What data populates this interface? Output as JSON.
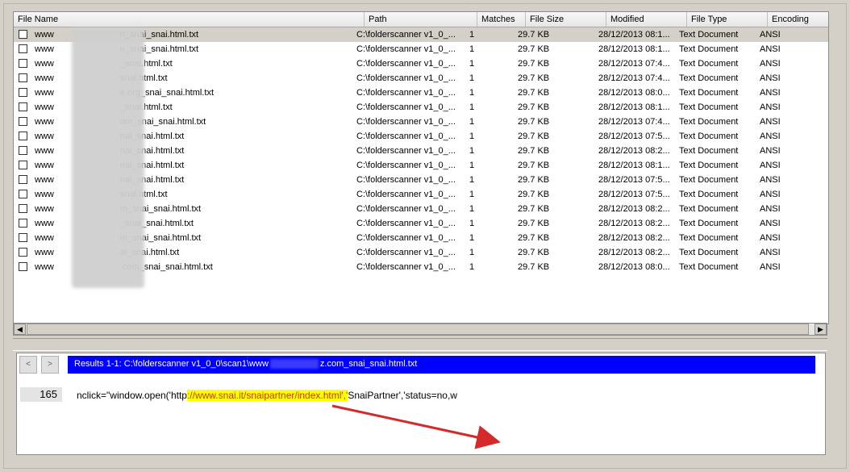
{
  "columns": {
    "name": "File Name",
    "path": "Path",
    "matches": "Matches",
    "size": "File Size",
    "modified": "Modified",
    "type": "File Type",
    "encoding": "Encoding"
  },
  "rows": [
    {
      "name": "www",
      "suffix": "n_snai_snai.html.txt",
      "path": "C:\\folderscanner v1_0_...",
      "matches": "1",
      "size": "29.7 KB",
      "modified": "28/12/2013 08:1...",
      "type": "Text Document",
      "enc": "ANSI",
      "selected": true
    },
    {
      "name": "www",
      "suffix": "n_snai_snai.html.txt",
      "path": "C:\\folderscanner v1_0_...",
      "matches": "1",
      "size": "29.7 KB",
      "modified": "28/12/2013 08:1...",
      "type": "Text Document",
      "enc": "ANSI"
    },
    {
      "name": "www",
      "suffix": "_snai.html.txt",
      "path": "C:\\folderscanner v1_0_...",
      "matches": "1",
      "size": "29.7 KB",
      "modified": "28/12/2013 07:4...",
      "type": "Text Document",
      "enc": "ANSI"
    },
    {
      "name": "www",
      "suffix": "snai.html.txt",
      "path": "C:\\folderscanner v1_0_...",
      "matches": "1",
      "size": "29.7 KB",
      "modified": "28/12/2013 07:4...",
      "type": "Text Document",
      "enc": "ANSI"
    },
    {
      "name": "www",
      "suffix": "e.org_snai_snai.html.txt",
      "path": "C:\\folderscanner v1_0_...",
      "matches": "1",
      "size": "29.7 KB",
      "modified": "28/12/2013 08:0...",
      "type": "Text Document",
      "enc": "ANSI"
    },
    {
      "name": "www",
      "suffix": "_snai.html.txt",
      "path": "C:\\folderscanner v1_0_...",
      "matches": "1",
      "size": "29.7 KB",
      "modified": "28/12/2013 08:1...",
      "type": "Text Document",
      "enc": "ANSI"
    },
    {
      "name": "www",
      "suffix": "om_snai_snai.html.txt",
      "path": "C:\\folderscanner v1_0_...",
      "matches": "1",
      "size": "29.7 KB",
      "modified": "28/12/2013 07:4...",
      "type": "Text Document",
      "enc": "ANSI"
    },
    {
      "name": "www",
      "suffix": "nai_snai.html.txt",
      "path": "C:\\folderscanner v1_0_...",
      "matches": "1",
      "size": "29.7 KB",
      "modified": "28/12/2013 07:5...",
      "type": "Text Document",
      "enc": "ANSI"
    },
    {
      "name": "www",
      "suffix": "nai_snai.html.txt",
      "path": "C:\\folderscanner v1_0_...",
      "matches": "1",
      "size": "29.7 KB",
      "modified": "28/12/2013 08:2...",
      "type": "Text Document",
      "enc": "ANSI"
    },
    {
      "name": "www",
      "suffix": "nai_snai.html.txt",
      "path": "C:\\folderscanner v1_0_...",
      "matches": "1",
      "size": "29.7 KB",
      "modified": "28/12/2013 08:1...",
      "type": "Text Document",
      "enc": "ANSI"
    },
    {
      "name": "www",
      "suffix": "nai_snai.html.txt",
      "path": "C:\\folderscanner v1_0_...",
      "matches": "1",
      "size": "29.7 KB",
      "modified": "28/12/2013 07:5...",
      "type": "Text Document",
      "enc": "ANSI"
    },
    {
      "name": "www",
      "suffix": "snai.html.txt",
      "path": "C:\\folderscanner v1_0_...",
      "matches": "1",
      "size": "29.7 KB",
      "modified": "28/12/2013 07:5...",
      "type": "Text Document",
      "enc": "ANSI"
    },
    {
      "name": "www",
      "suffix": "m_snai_snai.html.txt",
      "path": "C:\\folderscanner v1_0_...",
      "matches": "1",
      "size": "29.7 KB",
      "modified": "28/12/2013 08:2...",
      "type": "Text Document",
      "enc": "ANSI"
    },
    {
      "name": "www",
      "suffix": "_snai_snai.html.txt",
      "path": "C:\\folderscanner v1_0_...",
      "matches": "1",
      "size": "29.7 KB",
      "modified": "28/12/2013 08:2...",
      "type": "Text Document",
      "enc": "ANSI"
    },
    {
      "name": "www",
      "suffix": "m_snai_snai.html.txt",
      "path": "C:\\folderscanner v1_0_...",
      "matches": "1",
      "size": "29.7 KB",
      "modified": "28/12/2013 08:2...",
      "type": "Text Document",
      "enc": "ANSI"
    },
    {
      "name": "www",
      "suffix": "ai_snai.html.txt",
      "path": "C:\\folderscanner v1_0_...",
      "matches": "1",
      "size": "29.7 KB",
      "modified": "28/12/2013 08:2...",
      "type": "Text Document",
      "enc": "ANSI"
    },
    {
      "name": "www",
      "suffix": ".com_snai_snai.html.txt",
      "path": "C:\\folderscanner v1_0_...",
      "matches": "1",
      "size": "29.7 KB",
      "modified": "28/12/2013 08:0...",
      "type": "Text Document",
      "enc": "ANSI"
    }
  ],
  "preview": {
    "prev_label": "<",
    "next_label": ">",
    "results_prefix": "Results 1-1: C:\\folderscanner v1_0_0\\scan1\\www",
    "results_suffix": "z.com_snai_snai.html.txt",
    "line_number": "165",
    "code_before": "nclick=\"window.open('http",
    "code_match": "://www.snai.it/snaipartner/index.html','",
    "code_after": "SnaiPartner','status=no,w"
  },
  "scrollbar": {
    "left_arrow": "◀",
    "right_arrow": "▶"
  },
  "colors": {
    "results_bar": "#0000ff",
    "highlight": "#ffff00",
    "arrow": "#d42a2a"
  }
}
